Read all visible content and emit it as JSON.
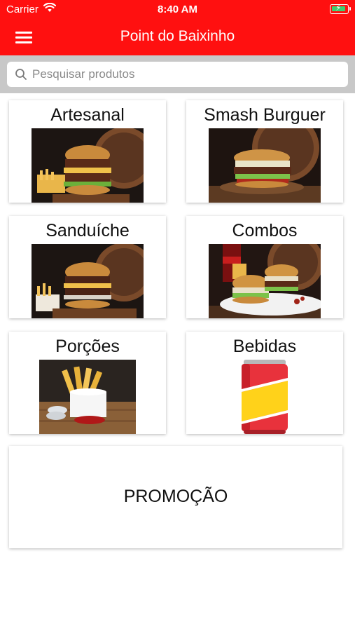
{
  "status_bar": {
    "carrier": "Carrier",
    "time": "8:40 AM"
  },
  "header": {
    "title": "Point do Baixinho",
    "menu_icon": "hamburger-menu-icon"
  },
  "search": {
    "placeholder": "Pesquisar produtos",
    "value": ""
  },
  "categories": [
    {
      "label": "Artesanal",
      "image": "burger-photo"
    },
    {
      "label": "Smash Burguer",
      "image": "smash-burger-photo"
    },
    {
      "label": "Sanduíche",
      "image": "sandwich-photo"
    },
    {
      "label": "Combos",
      "image": "combo-photo"
    },
    {
      "label": "Porções",
      "image": "fries-photo"
    },
    {
      "label": "Bebidas",
      "image": "soda-can-illustration"
    }
  ],
  "promo": {
    "label": "PROMOÇÃO"
  },
  "colors": {
    "brand_red": "#ff1010",
    "search_bg": "#c8c8c8"
  }
}
